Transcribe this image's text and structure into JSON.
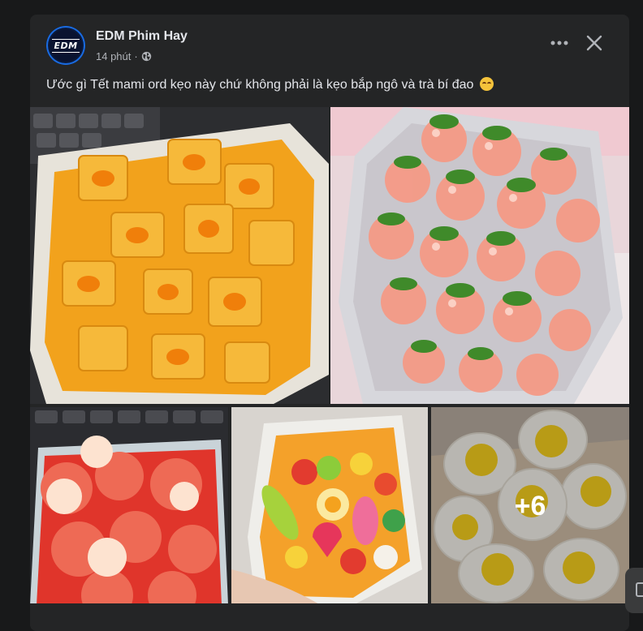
{
  "post": {
    "author": "EDM Phim Hay",
    "avatar_text": "EDM",
    "time": "14 phút",
    "separator": "·",
    "privacy_icon": "globe-icon",
    "caption": "Ước gì Tết mami ord kẹo này chứ không phải là kẹo bắp ngô và trà bí đao",
    "caption_emoji": "relieved-face-emoji"
  },
  "actions": {
    "more_icon": "more-horizontal-icon",
    "close_icon": "close-icon"
  },
  "gallery": {
    "photos": [
      {
        "subject": "corn-candy-photo"
      },
      {
        "subject": "strawberry-gummies-photo"
      },
      {
        "subject": "lychee-jelly-photo"
      },
      {
        "subject": "mixed-gummies-photo"
      },
      {
        "subject": "egg-gummies-photo"
      }
    ],
    "more_count": "+6"
  },
  "colors": {
    "background": "#18191a",
    "card": "#242526",
    "primary_text": "#e4e6eb",
    "secondary_text": "#b0b3b8"
  }
}
